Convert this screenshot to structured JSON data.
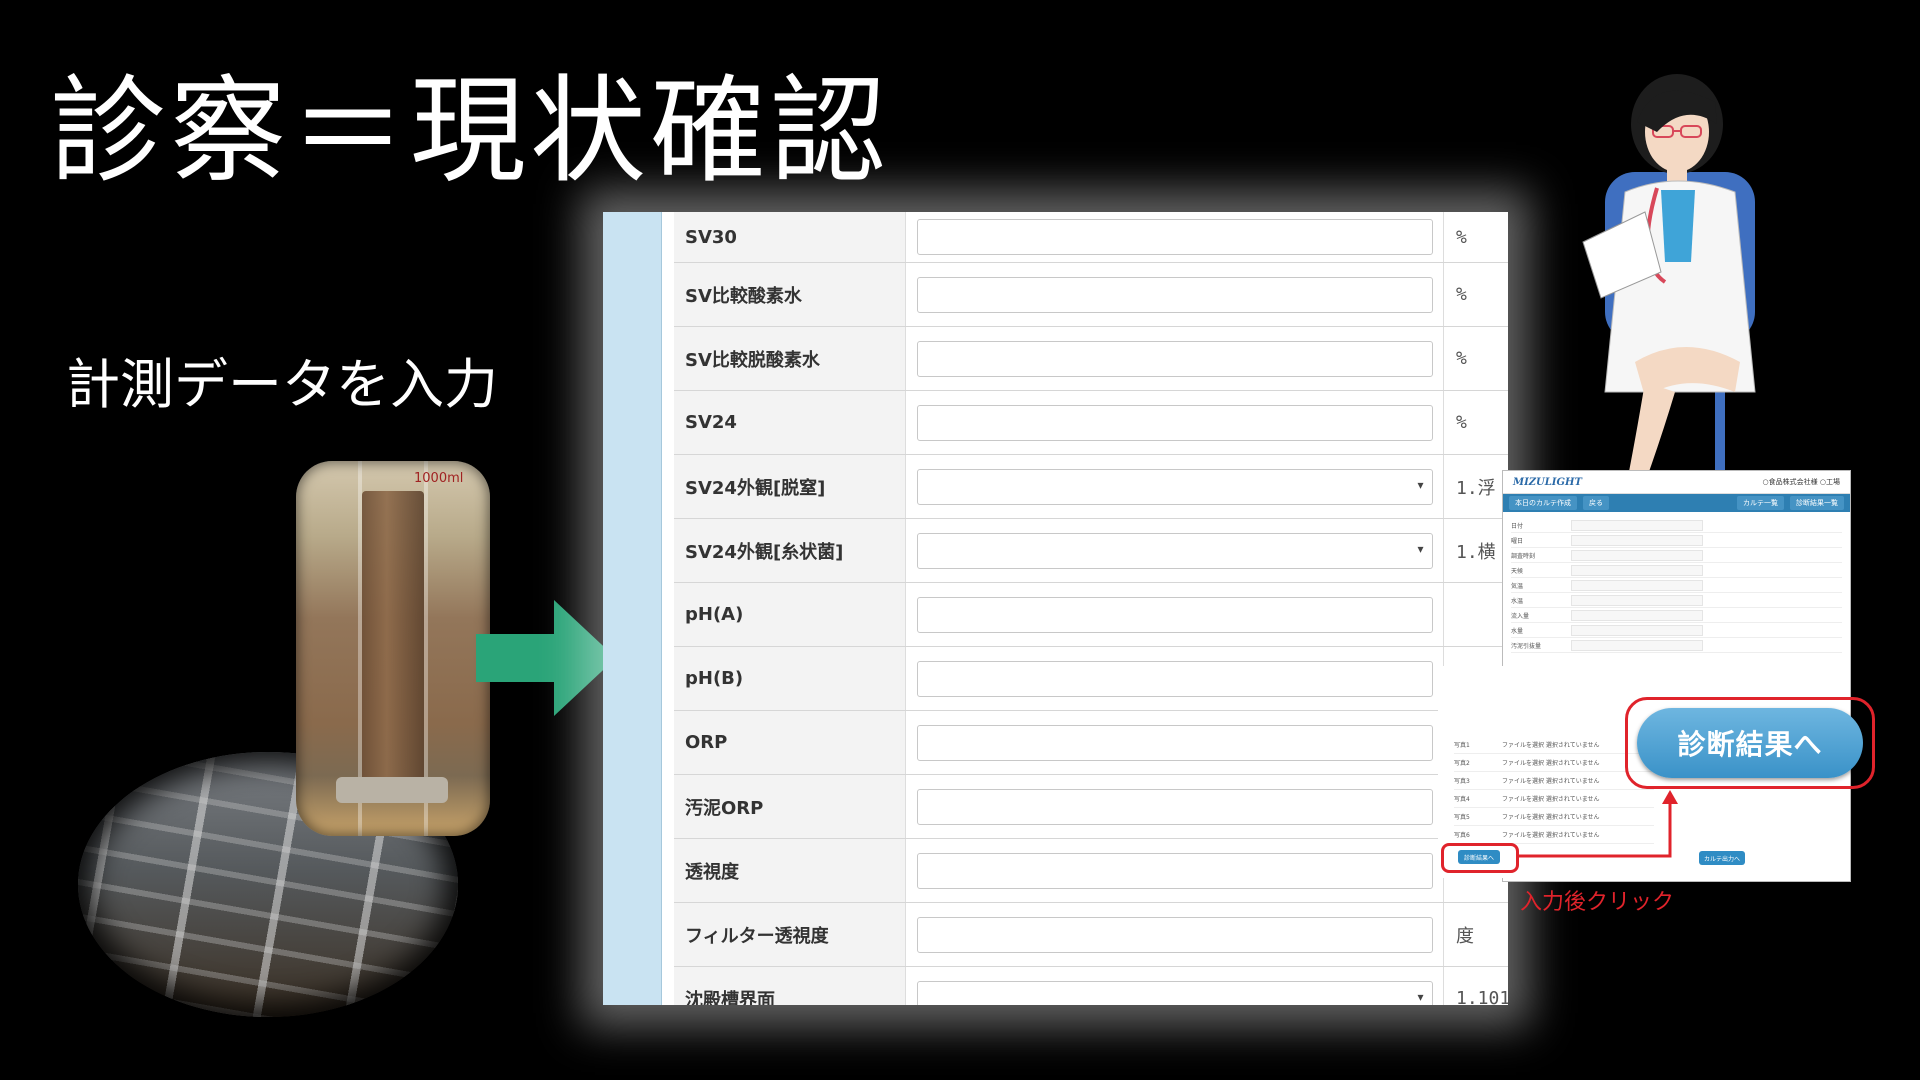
{
  "slide": {
    "title": "診察＝現状確認",
    "subtitle": "計測データを入力"
  },
  "photos": {
    "cylinder_label": "1000ml"
  },
  "form": {
    "rows": [
      {
        "label": "SV30",
        "type": "text",
        "unit": "%"
      },
      {
        "label": "SV比較酸素水",
        "type": "text",
        "unit": "%"
      },
      {
        "label": "SV比較脱酸素水",
        "type": "text",
        "unit": "%"
      },
      {
        "label": "SV24",
        "type": "text",
        "unit": "%"
      },
      {
        "label": "SV24外観[脱窒]",
        "type": "select",
        "unit": "1.浮"
      },
      {
        "label": "SV24外観[糸状菌]",
        "type": "select",
        "unit": "1.横"
      },
      {
        "label": "pH(A)",
        "type": "text",
        "unit": ""
      },
      {
        "label": "pH(B)",
        "type": "text",
        "unit": ""
      },
      {
        "label": "ORP",
        "type": "text",
        "unit": ""
      },
      {
        "label": "汚泥ORP",
        "type": "text",
        "unit": ""
      },
      {
        "label": "透視度",
        "type": "text",
        "unit": ""
      },
      {
        "label": "フィルター透視度",
        "type": "text",
        "unit": "度"
      },
      {
        "label": "沈殿槽界面",
        "type": "select",
        "unit": "1.101"
      }
    ]
  },
  "app": {
    "logo": "MIZULIGHT",
    "company": "○食品株式会社様 ○工場",
    "nav_left": "本日のカルテ作成",
    "nav_back": "戻る",
    "nav_list": "カルテ一覧",
    "nav_results": "診断結果一覧",
    "fields": [
      "日付",
      "曜日",
      "調査時刻",
      "天候",
      "気温",
      "水温",
      "流入量",
      "水量",
      "汚泥引抜量"
    ],
    "photo_rows": [
      "写真1",
      "写真2",
      "写真3",
      "写真4",
      "写真5",
      "写真6"
    ],
    "photo_placeholder": "ファイルを選択 選択されていません",
    "small_diag_button": "診断結果へ",
    "small_pdf_button": "カルテ出力へ"
  },
  "diagnosis_button": "診断結果へ",
  "hint": "入力後クリック",
  "colors": {
    "background": "#000000",
    "arrow": "#2aa478",
    "button_blue": "#3a92c8",
    "highlight_red": "#e0232b",
    "sidebar_blue": "#c9e3f2"
  }
}
